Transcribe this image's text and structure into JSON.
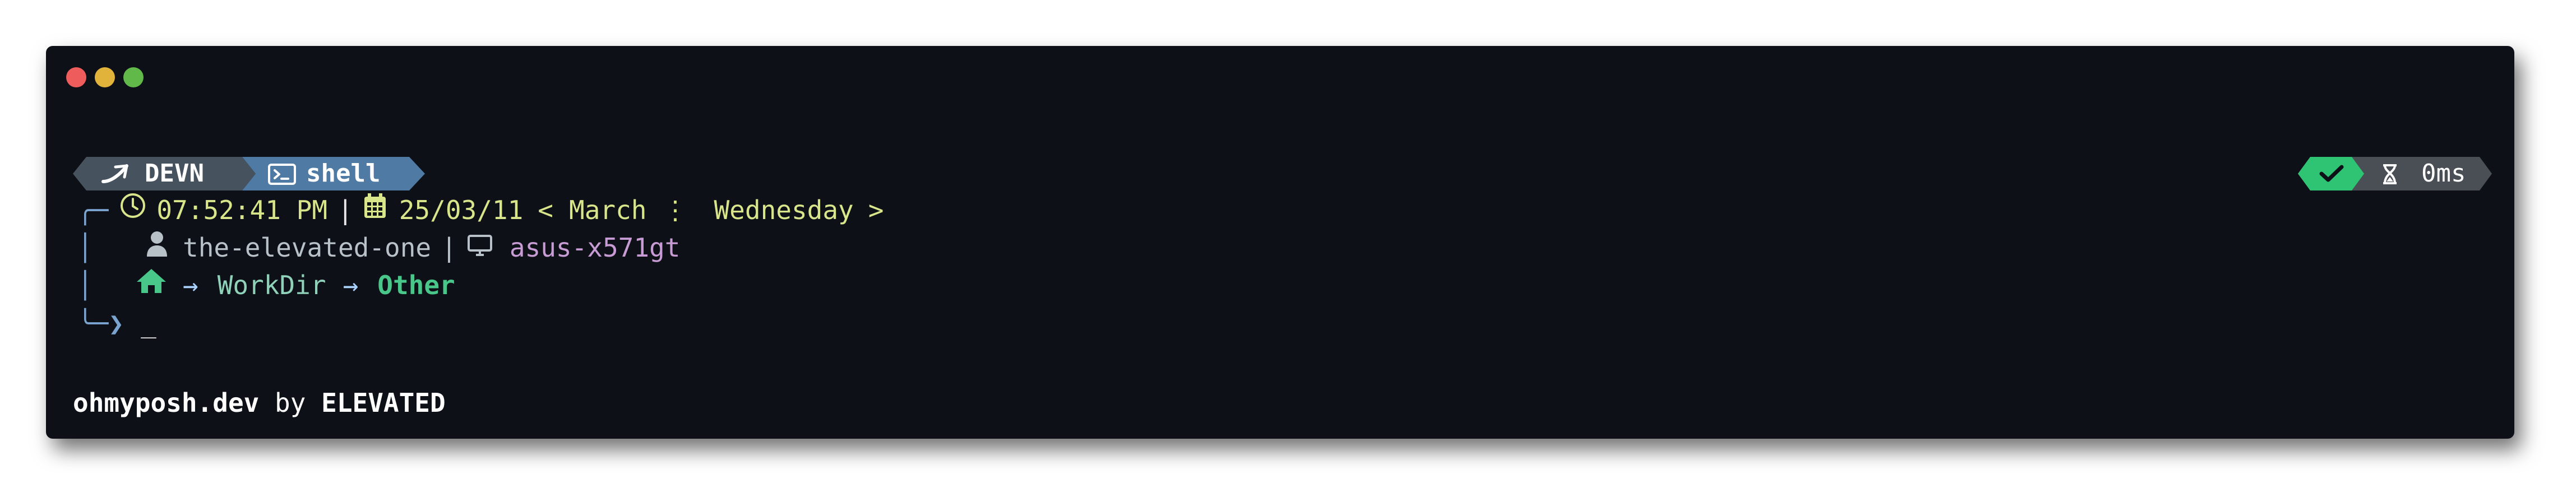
{
  "window": {
    "controls": [
      "close",
      "minimize",
      "maximize"
    ]
  },
  "prompt_top": {
    "segment1_label": "DEVN",
    "segment1_icon": "arrow-icon",
    "segment2_label": "shell",
    "segment2_icon": "terminal-icon",
    "status_icon": "check-icon",
    "duration_icon": "hourglass-icon",
    "duration": "0ms"
  },
  "line1": {
    "time": "07:52:41 PM",
    "sep1": "|",
    "date": "25/03/11",
    "left_bracket": "<",
    "month": "March",
    "sep2": "⋮",
    "weekday": "Wednesday",
    "right_bracket": ">"
  },
  "line2": {
    "user": "the-elevated-one",
    "sep": "|",
    "host": "asus-x571gt"
  },
  "line3": {
    "arrow1": "→",
    "dir1": "WorkDir",
    "arrow2": "→",
    "dir2": "Other"
  },
  "line4": {
    "cursor": "_"
  },
  "footer": {
    "site": "ohmyposh.dev",
    "by": "by",
    "author": "ELEVATED"
  },
  "colors": {
    "background": "#0d1017",
    "segment1": "#46525e",
    "segment2": "#4f7aa3",
    "status_ok": "#2fc473",
    "duration_bg": "#4a4f55"
  }
}
